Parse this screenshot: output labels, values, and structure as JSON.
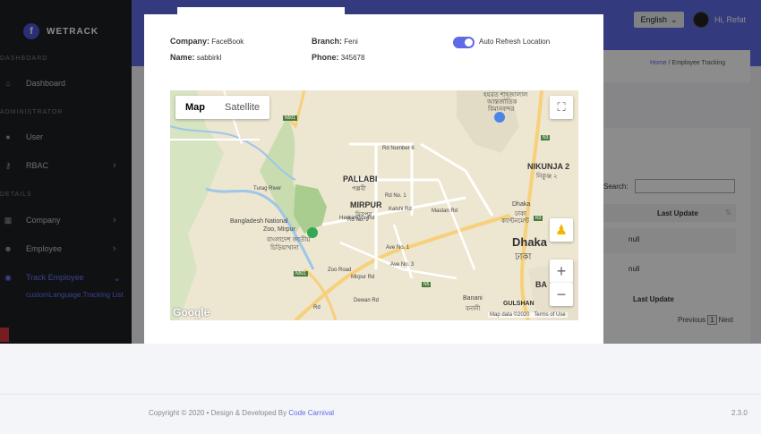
{
  "app": {
    "name": "WETRACK"
  },
  "sidebar": {
    "sections": [
      "DASHBOARD",
      "ADMINISTRATOR",
      "DETAILS"
    ],
    "items": [
      {
        "label": "Dashboard"
      },
      {
        "label": "User"
      },
      {
        "label": "RBAC"
      },
      {
        "label": "Company"
      },
      {
        "label": "Employee"
      },
      {
        "label": "Track Employee"
      }
    ],
    "sub_item": "customLanguage.Tracking List"
  },
  "header": {
    "language": "English",
    "greeting": "Hi, Refat"
  },
  "breadcrumb": {
    "home": "Home",
    "sep": "/",
    "current": "Employee Tracking"
  },
  "table": {
    "search_label": "Search:",
    "column": "Last Update",
    "rows": [
      "null",
      "null"
    ],
    "footer_column": "Last Update",
    "pager": {
      "previous": "Previous",
      "page": "1",
      "next": "Next"
    }
  },
  "modal": {
    "company_label": "Company:",
    "company_value": "FaceBook",
    "name_label": "Name:",
    "name_value": "sabbirkl",
    "branch_label": "Branch:",
    "branch_value": "Feni",
    "phone_label": "Phone:",
    "phone_value": "345678",
    "toggle_label": "Auto Refresh Location",
    "toggle_on": true
  },
  "map": {
    "type_map": "Map",
    "type_satellite": "Satellite",
    "labels": {
      "pallabi": "PALLABI",
      "pallabi_bn": "পল্লবী",
      "mirpur": "MIRPUR",
      "mirpur_bn": "মিরপুর",
      "zoo": "Bangladesh National",
      "zoo2": "Zoo, Mirpur",
      "zoo_bn": "বাংলাদেশ জাতীয়",
      "zoo_bn2": "চিড়িয়াখানা",
      "nikunja": "NIKUNJA 2",
      "nikunja_bn": "নিকুঞ্জ ২",
      "dhaka_cant": "Dhaka",
      "dhaka_cant_bn": "ঢাকা",
      "dhaka_cant_bn2": "ক্যান্টনমেন্ট",
      "dhaka": "Dhaka",
      "dhaka_bn": "ঢাকা",
      "banani": "Banani",
      "banani_bn": "বনানী",
      "gulshan": "GULSHAN",
      "ba": "BA",
      "airport_bn": "হযরত শাহজালাল",
      "airport_bn2": "আন্তর্জাতিক",
      "airport_bn3": "বিমানবন্দর",
      "rd_number": "Rd Number 6",
      "rd9": "Rd No. 9",
      "rd1": "Rd No. 1",
      "kalshi": "Kalshi Rd",
      "mastan": "Mastan Rd",
      "mirpur_rd": "Mirpur Rd",
      "zoo_road": "Zoo Road",
      "ave1": "Ave No. 1",
      "ave3": "Ave No. 3",
      "dewan": "Dewan Rd",
      "harirampur": "Harirampur Rd",
      "turag": "Turag River",
      "n501": "N501",
      "n3": "N3",
      "n5": "N5",
      "r": "Rd"
    },
    "attribution": "Map data ©2020",
    "terms": "Terms of Use",
    "google": "Google"
  },
  "footer": {
    "copyright": "Copyright © 2020  •  Design & Developed By",
    "link": "Code Carnival",
    "version": "2.3.0"
  }
}
